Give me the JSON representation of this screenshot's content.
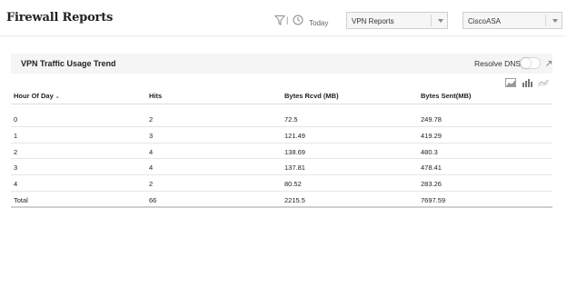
{
  "header": {
    "title": "Firewall Reports",
    "separator": "|",
    "date_range": "Today",
    "report_select": {
      "value": "VPN Reports"
    },
    "device_select": {
      "value": "CiscoASA"
    }
  },
  "panel": {
    "title": "VPN Traffic Usage Trend",
    "resolve_dns_label": "Resolve DNS",
    "resolve_dns_on": false
  },
  "chart_view_icons": [
    "area-chart-icon",
    "bar-chart-icon",
    "line-chart-icon"
  ],
  "table": {
    "columns": [
      "Hour Of Day",
      "Hits",
      "Bytes Rcvd (MB)",
      "Bytes Sent(MB)"
    ],
    "sort_indicator": "▲",
    "rows": [
      [
        "0",
        "2",
        "72.5",
        "249.78"
      ],
      [
        "1",
        "3",
        "121.49",
        "419.29"
      ],
      [
        "2",
        "4",
        "138.69",
        "480.3"
      ],
      [
        "3",
        "4",
        "137.81",
        "478.41"
      ],
      [
        "4",
        "2",
        "80.52",
        "283.26"
      ]
    ],
    "total": [
      "Total",
      "66",
      "2215.5",
      "7697.59"
    ]
  },
  "colors": {
    "panel_header_bg": "#f5f5f5",
    "select_bg": "#f6f6f6",
    "text": "#222222",
    "icon_gray": "#888888"
  }
}
